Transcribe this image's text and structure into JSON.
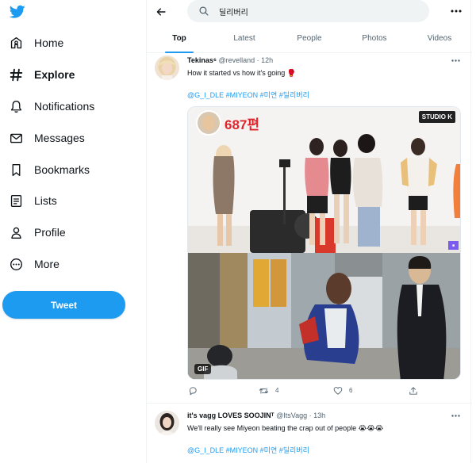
{
  "sidebar": {
    "logo": "twitter-bird-icon",
    "items": [
      {
        "label": "Home",
        "icon": "home-icon"
      },
      {
        "label": "Explore",
        "icon": "hashtag-icon",
        "active": true
      },
      {
        "label": "Notifications",
        "icon": "bell-icon"
      },
      {
        "label": "Messages",
        "icon": "envelope-icon"
      },
      {
        "label": "Bookmarks",
        "icon": "bookmark-icon"
      },
      {
        "label": "Lists",
        "icon": "list-icon"
      },
      {
        "label": "Profile",
        "icon": "person-icon"
      },
      {
        "label": "More",
        "icon": "more-circle-icon"
      }
    ],
    "tweet_button": "Tweet"
  },
  "search": {
    "query": "딜리버리"
  },
  "tabs": [
    {
      "label": "Top",
      "active": true
    },
    {
      "label": "Latest"
    },
    {
      "label": "People"
    },
    {
      "label": "Photos"
    },
    {
      "label": "Videos"
    }
  ],
  "tweets": [
    {
      "name": "Tekinas⁶",
      "meta": "@revelland · 12h",
      "text": "How it started vs how it's going 🥊",
      "tags": "@G_I_DLE #MIYEON #미연 #딜리버리",
      "media": {
        "episode_label": "687편",
        "studio_logo": "STUDIO K",
        "gif_badge": "GIF"
      },
      "actions": {
        "replies": "",
        "retweets": "4",
        "likes": "6"
      }
    },
    {
      "name": "it's vagg LOVES SOOJINᵀ",
      "meta": "@ItsVagg · 13h",
      "text": "We'll really see Miyeon beating the crap out of people 😭😭😭",
      "tags": "@G_I_DLE #MIYEON #미연 #딜리버리"
    }
  ],
  "colors": {
    "accent": "#1d9bf0",
    "text": "#0f1419",
    "muted": "#536471",
    "episode_label": "#e0252c"
  }
}
